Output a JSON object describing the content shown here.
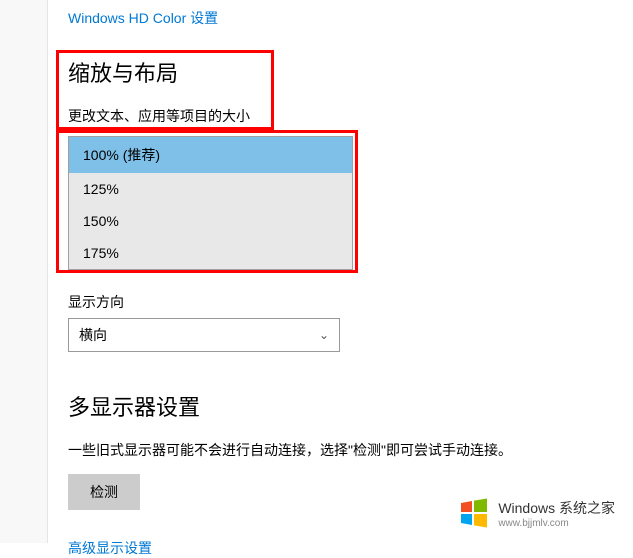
{
  "hd_color_link": "Windows HD Color 设置",
  "scale_section": {
    "title": "缩放与布局",
    "subtitle": "更改文本、应用等项目的大小",
    "options": [
      "100% (推荐)",
      "125%",
      "150%",
      "175%"
    ],
    "selected_index": 0
  },
  "orientation": {
    "label": "显示方向",
    "value": "横向"
  },
  "multi_monitor": {
    "title": "多显示器设置",
    "description": "一些旧式显示器可能不会进行自动连接，选择\"检测\"即可尝试手动连接。",
    "detect_button": "检测"
  },
  "advanced_link": "高级显示设置",
  "watermark": {
    "title": "Windows 系统之家",
    "url": "www.bjjmlv.com"
  }
}
